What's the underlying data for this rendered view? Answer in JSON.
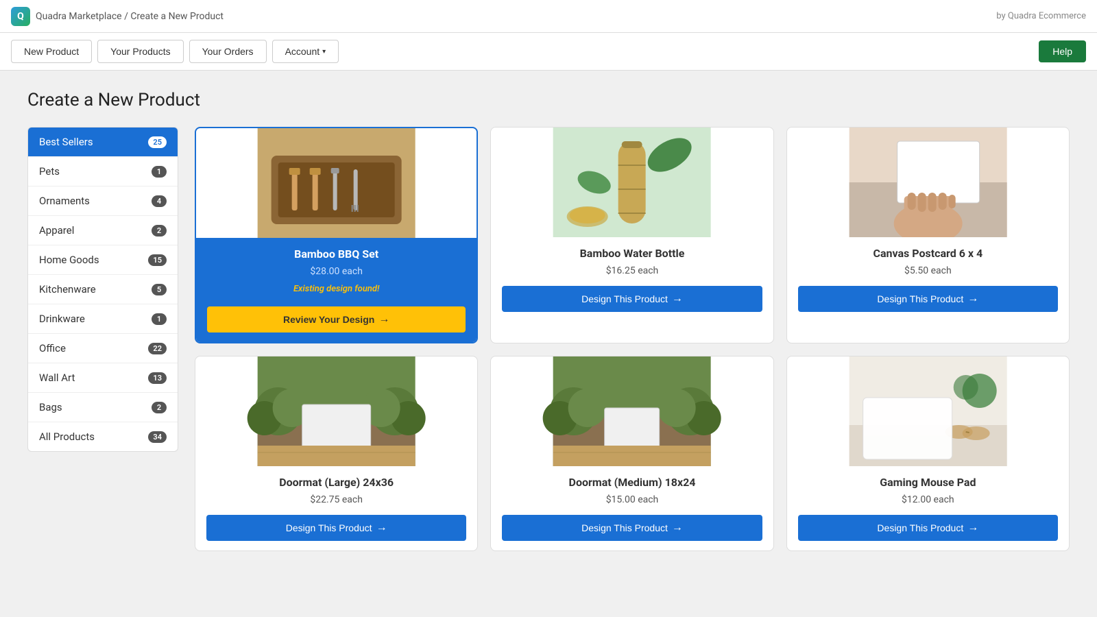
{
  "brand": {
    "logo_text": "Q",
    "breadcrumb": "Quadra Marketplace / Create a New Product",
    "by_text": "by Quadra Ecommerce"
  },
  "nav": {
    "new_product": "New Product",
    "your_products": "Your Products",
    "your_orders": "Your Orders",
    "account": "Account",
    "help": "Help"
  },
  "page": {
    "title": "Create a New Product"
  },
  "sidebar": {
    "items": [
      {
        "label": "Best Sellers",
        "count": "25",
        "active": true
      },
      {
        "label": "Pets",
        "count": "1",
        "active": false
      },
      {
        "label": "Ornaments",
        "count": "4",
        "active": false
      },
      {
        "label": "Apparel",
        "count": "2",
        "active": false
      },
      {
        "label": "Home Goods",
        "count": "15",
        "active": false
      },
      {
        "label": "Kitchenware",
        "count": "5",
        "active": false
      },
      {
        "label": "Drinkware",
        "count": "1",
        "active": false
      },
      {
        "label": "Office",
        "count": "22",
        "active": false
      },
      {
        "label": "Wall Art",
        "count": "13",
        "active": false
      },
      {
        "label": "Bags",
        "count": "2",
        "active": false
      },
      {
        "label": "All Products",
        "count": "34",
        "active": false
      }
    ]
  },
  "products": [
    {
      "id": "bamboo-bbq",
      "name": "Bamboo BBQ Set",
      "price": "$28.00 each",
      "featured": true,
      "has_design": true,
      "existing_design_label": "Existing design found!",
      "btn_label": "Review Your Design",
      "btn_type": "review",
      "img_type": "bbq",
      "img_emoji": "🍖"
    },
    {
      "id": "bamboo-bottle",
      "name": "Bamboo Water Bottle",
      "price": "$16.25 each",
      "featured": false,
      "has_design": false,
      "btn_label": "Design This Product",
      "btn_type": "design",
      "img_type": "bottle",
      "img_emoji": "🍶"
    },
    {
      "id": "canvas-postcard",
      "name": "Canvas Postcard 6 x 4",
      "price": "$5.50 each",
      "featured": false,
      "has_design": false,
      "btn_label": "Design This Product",
      "btn_type": "design",
      "img_type": "postcard",
      "img_emoji": "🖼️"
    },
    {
      "id": "doormat-large",
      "name": "Doormat (Large) 24x36",
      "price": "$22.75 each",
      "featured": false,
      "has_design": false,
      "btn_label": "Design This Product",
      "btn_type": "design",
      "img_type": "doormat-lg",
      "img_emoji": "🚪"
    },
    {
      "id": "doormat-medium",
      "name": "Doormat (Medium) 18x24",
      "price": "$15.00 each",
      "featured": false,
      "has_design": false,
      "btn_label": "Design This Product",
      "btn_type": "design",
      "img_type": "doormat-md",
      "img_emoji": "🚪"
    },
    {
      "id": "gaming-mousepad",
      "name": "Gaming Mouse Pad",
      "price": "$12.00 each",
      "featured": false,
      "has_design": false,
      "btn_label": "Design This Product",
      "btn_type": "design",
      "img_type": "mousepad",
      "img_emoji": "🖱️"
    }
  ],
  "colors": {
    "active_blue": "#1a6fd4",
    "review_yellow": "#ffc107",
    "help_green": "#1a7a3c"
  }
}
